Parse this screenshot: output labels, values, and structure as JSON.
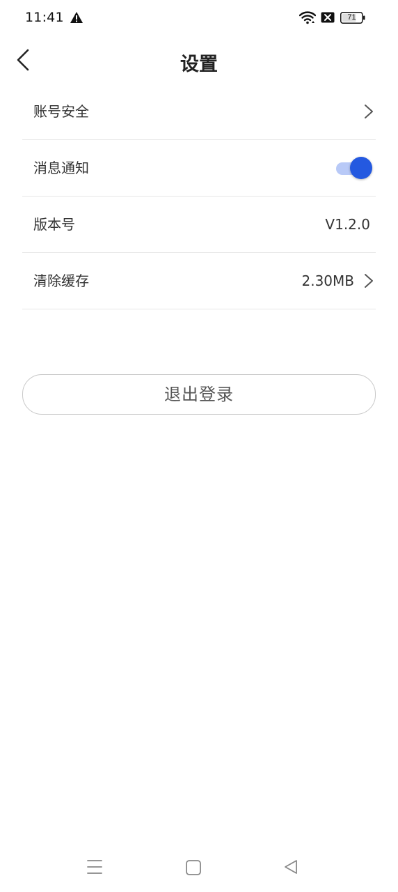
{
  "status_bar": {
    "time": "11:41",
    "battery_level": "71",
    "icons": [
      "warning-icon",
      "wifi-icon",
      "no-sim-icon",
      "battery-icon"
    ]
  },
  "header": {
    "title": "设置",
    "back_icon": "chevron-left-icon"
  },
  "settings": {
    "items": [
      {
        "label": "账号安全",
        "value": "",
        "accessory": "chevron-right-icon"
      },
      {
        "label": "消息通知",
        "value": "",
        "accessory": "toggle",
        "enabled": true
      },
      {
        "label": "版本号",
        "value": "V1.2.0",
        "accessory": ""
      },
      {
        "label": "清除缓存",
        "value": "2.30MB",
        "accessory": "chevron-right-icon"
      }
    ]
  },
  "logout": {
    "label": "退出登录"
  },
  "nav_bar": {
    "icons": [
      "menu-icon",
      "home-square-icon",
      "back-triangle-icon"
    ]
  },
  "colors": {
    "accent": "#2459e0",
    "accent_track": "#b8c9f7",
    "divider": "#e6e6e6",
    "text": "#333333"
  }
}
